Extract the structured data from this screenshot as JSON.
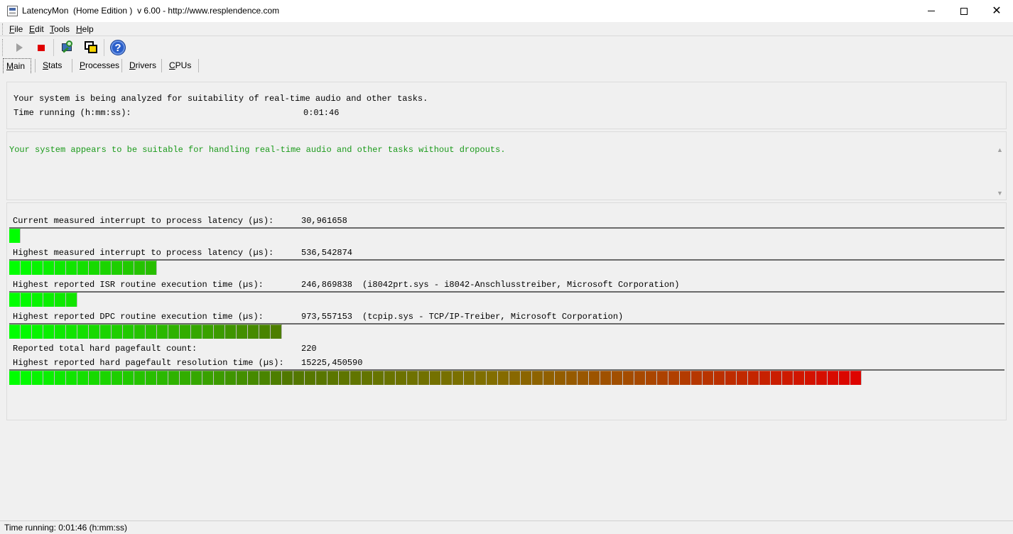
{
  "window": {
    "title": "LatencyMon  (Home Edition )  v 6.00 - http://www.resplendence.com"
  },
  "menu": [
    {
      "key": "F",
      "rest": "ile"
    },
    {
      "key": "E",
      "rest": "dit"
    },
    {
      "key": "T",
      "rest": "ools"
    },
    {
      "key": "H",
      "rest": "elp"
    }
  ],
  "toolbar": {
    "icons": [
      "play-icon",
      "stop-icon",
      "analyze-icon",
      "windows-icon",
      "help-icon"
    ],
    "help_glyph": "?"
  },
  "tabs": [
    {
      "key": "M",
      "rest": "ain"
    },
    {
      "key": "S",
      "rest": "tats"
    },
    {
      "key": "P",
      "rest": "rocesses"
    },
    {
      "key": "D",
      "rest": "rivers"
    },
    {
      "key": "C",
      "rest": "PUs"
    }
  ],
  "summary": {
    "line1": "Your system is being analyzed for suitability of real-time audio and other tasks.",
    "time_label": "Time running (h:mm:ss):",
    "time_value": "0:01:46"
  },
  "verdict": {
    "text": "Your system appears to be suitable for handling real-time audio and other tasks without dropouts.",
    "color": "#1a9a1a"
  },
  "measurements": {
    "current_latency": {
      "label": "Current measured interrupt to process latency (µs):",
      "value": "30,961658",
      "segments": 1
    },
    "highest_latency": {
      "label": "Highest measured interrupt to process latency (µs):",
      "value": "536,542874",
      "segments": 13
    },
    "isr": {
      "label": "Highest reported ISR routine execution time (µs):",
      "value": "246,869838",
      "detail": "(i8042prt.sys - i8042-Anschlusstreiber, Microsoft Corporation)",
      "segments": 6
    },
    "dpc": {
      "label": "Highest reported DPC routine execution time (µs):",
      "value": "973,557153",
      "detail": "(tcpip.sys - TCP/IP-Treiber, Microsoft Corporation)",
      "segments": 24
    },
    "pagefault_count": {
      "label": "Reported total hard pagefault count:",
      "value": "220"
    },
    "pagefault_time": {
      "label": "Highest reported hard pagefault resolution time (µs):",
      "value": "15225,450590",
      "segments": 75
    }
  },
  "status": {
    "text": "Time running: 0:01:46  (h:mm:ss)"
  }
}
